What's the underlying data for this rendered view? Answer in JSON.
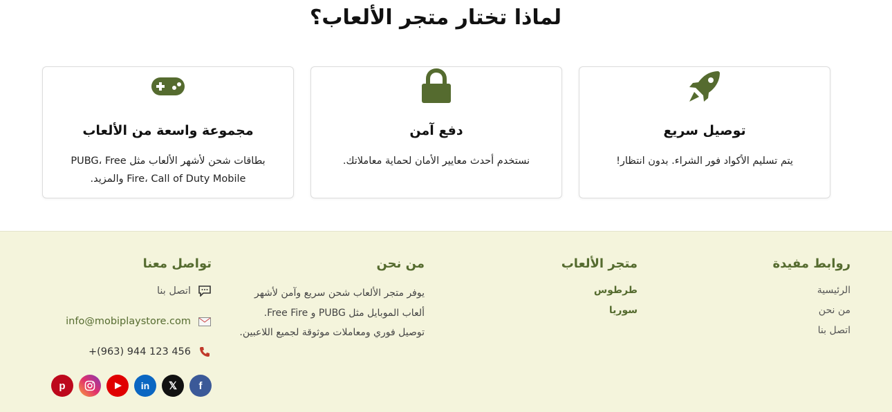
{
  "why": {
    "title": "لماذا تختار متجر الألعاب؟",
    "cards": [
      {
        "icon": "rocket-icon",
        "title": "توصيل سريع",
        "desc": "يتم تسليم الأكواد فور الشراء. بدون انتظار!"
      },
      {
        "icon": "lock-icon",
        "title": "دفع آمن",
        "desc": "نستخدم أحدث معايير الأمان لحماية معاملاتك."
      },
      {
        "icon": "gamepad-icon",
        "title": "مجموعة واسعة من الألعاب",
        "desc": "بطاقات شحن لأشهر الألعاب مثل PUBG، Free Fire، Call of Duty Mobile والمزيد."
      }
    ]
  },
  "footer": {
    "links": {
      "title": "روابط مفيدة",
      "items": [
        "الرئيسية",
        "من نحن",
        "اتصل بنا"
      ]
    },
    "store": {
      "title": "متجر الألعاب",
      "items": [
        "طرطوس",
        "سوريا"
      ]
    },
    "about": {
      "title": "من نحن",
      "text": "يوفر متجر الألعاب شحن سريع وآمن لأشهر ألعاب الموبايل مثل PUBG و Free Fire. توصيل فوري ومعاملات موثوقة لجميع اللاعبين."
    },
    "contact": {
      "title": "تواصل معنا",
      "contact_label": "اتصل بنا",
      "email": "info@mobiplaystore.com",
      "phone": "+(963) 944 123 456"
    },
    "socials": [
      "facebook-icon",
      "x-icon",
      "linkedin-icon",
      "youtube-icon",
      "instagram-icon",
      "pinterest-icon"
    ]
  },
  "colors": {
    "accent": "#556b2f",
    "footer_bg": "#f4f4dc",
    "icon_green": "#556b2f"
  }
}
